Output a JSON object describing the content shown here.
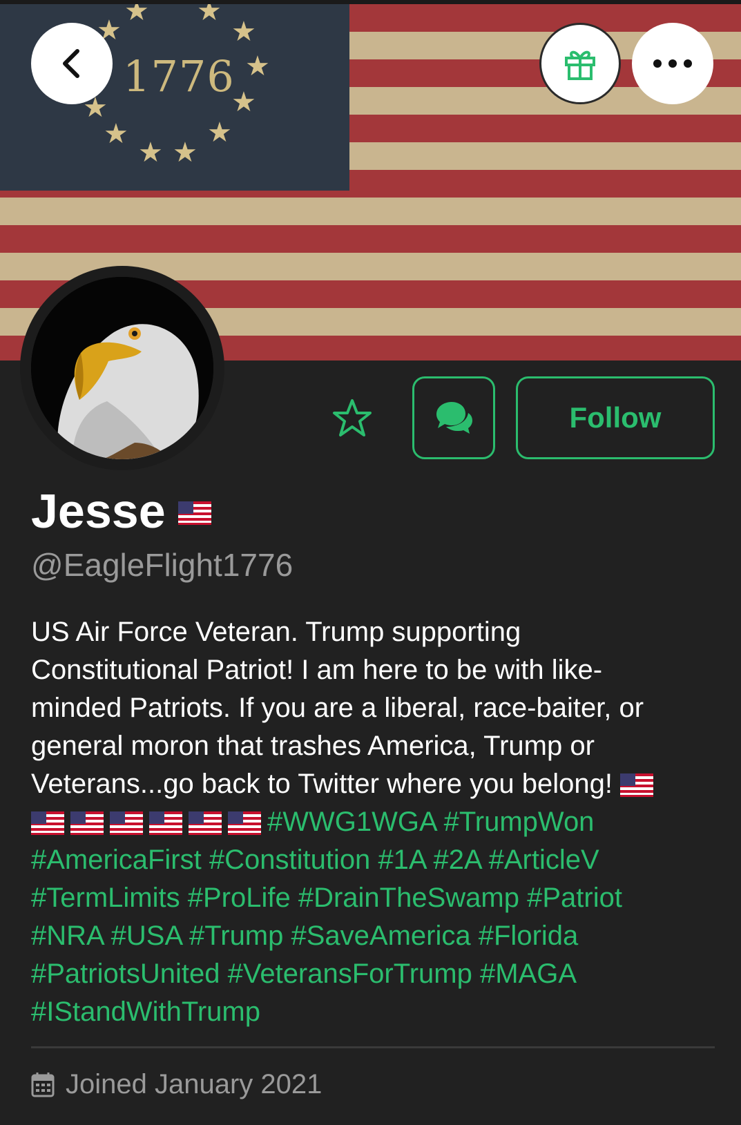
{
  "profile": {
    "display_name": "Jesse",
    "handle": "@EagleFlight1776",
    "banner_text": "1776",
    "bio_lines": [
      "US Air Force Veteran. Trump supporting",
      "Constitutional Patriot! I am here to be with like-",
      "minded Patriots. If you are a liberal, race-baiter, or",
      "general moron that trashes America, Trump or",
      "Veterans...go back to Twitter where you belong!"
    ],
    "hashtags": [
      "#WWG1WGA",
      "#TrumpWon",
      "#AmericaFirst",
      "#Constitution",
      "#1A",
      "#2A",
      "#ArticleV",
      "#TermLimits",
      "#ProLife",
      "#DrainTheSwamp",
      "#Patriot",
      "#NRA",
      "#USA",
      "#Trump",
      "#SaveAmerica",
      "#Florida",
      "#PatriotsUnited",
      "#VeteransForTrump",
      "#MAGA",
      "#IStandWithTrump"
    ],
    "joined": "Joined January 2021"
  },
  "actions": {
    "follow_label": "Follow"
  },
  "icons": {
    "back": "chevron-left-icon",
    "gift": "gift-icon",
    "more": "more-horizontal-icon",
    "favorite": "star-outline-icon",
    "message": "chat-bubbles-icon",
    "calendar": "calendar-icon",
    "flag": "us-flag-emoji"
  },
  "colors": {
    "accent": "#2bbd6e",
    "background": "#212121",
    "muted_text": "#9a9a9a"
  }
}
